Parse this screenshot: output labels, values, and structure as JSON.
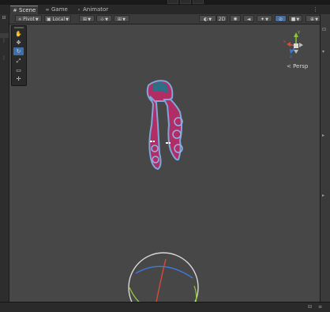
{
  "tabs": [
    {
      "label": "Scene",
      "icon": "grid-icon"
    },
    {
      "label": "Game",
      "icon": "gamepad-icon"
    },
    {
      "label": "Animator",
      "icon": "animator-icon"
    }
  ],
  "toolbar": {
    "pivot_label": "Pivot",
    "local_label": "Local",
    "mode_2d_label": "2D",
    "persp_label": "< Persp"
  },
  "scene_tools": [
    "hand-tool",
    "move-tool",
    "rotate-tool",
    "scale-tool",
    "rect-tool",
    "transform-tool"
  ],
  "gizmo_axes": {
    "y": "y",
    "x": "x",
    "z": "z"
  },
  "colors": {
    "accent": "#3f6ea8",
    "axis_x": "#d94a3a",
    "axis_y": "#8ec43c",
    "axis_z": "#3b7be0",
    "character_fill": "#b02d66",
    "character_outline": "#7ea6d8"
  }
}
